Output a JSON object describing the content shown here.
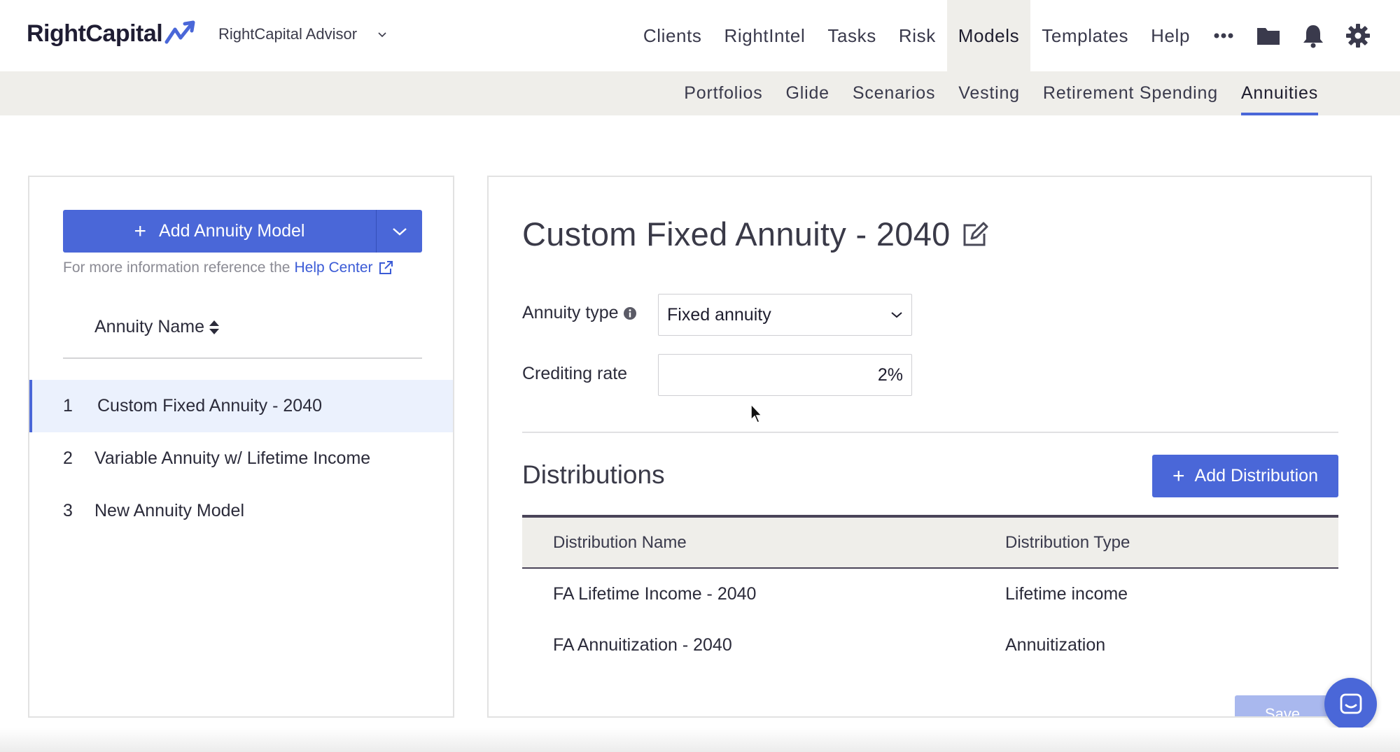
{
  "brand": {
    "logo_text": "RightCapital",
    "accent": "#4a67d8"
  },
  "advisor": {
    "label": "RightCapital Advisor"
  },
  "nav": {
    "items": [
      {
        "label": "Clients"
      },
      {
        "label": "RightIntel"
      },
      {
        "label": "Tasks"
      },
      {
        "label": "Risk"
      },
      {
        "label": "Models"
      },
      {
        "label": "Templates"
      },
      {
        "label": "Help"
      }
    ],
    "active": "Models",
    "icons": [
      "more-icon",
      "folder-icon",
      "bell-icon",
      "gear-icon"
    ]
  },
  "subnav": {
    "items": [
      {
        "label": "Portfolios"
      },
      {
        "label": "Glide"
      },
      {
        "label": "Scenarios"
      },
      {
        "label": "Vesting"
      },
      {
        "label": "Retirement Spending"
      },
      {
        "label": "Annuities"
      }
    ],
    "active": "Annuities"
  },
  "left": {
    "add_button": "Add Annuity Model",
    "help_prefix": "For more information reference the",
    "help_link": "Help Center",
    "column_header": "Annuity Name",
    "annuities": [
      {
        "index": "1",
        "name": "Custom Fixed Annuity - 2040"
      },
      {
        "index": "2",
        "name": "Variable Annuity w/ Lifetime Income"
      },
      {
        "index": "3",
        "name": "New Annuity Model"
      }
    ],
    "selected_index": 0
  },
  "detail": {
    "title": "Custom Fixed Annuity - 2040",
    "annuity_type_label": "Annuity type",
    "annuity_type_value": "Fixed annuity",
    "crediting_rate_label": "Crediting rate",
    "crediting_rate_value": "2%",
    "distributions_title": "Distributions",
    "add_distribution": "Add Distribution",
    "table_headers": {
      "name": "Distribution Name",
      "type": "Distribution Type"
    },
    "distributions": [
      {
        "name": "FA Lifetime Income - 2040",
        "type": "Lifetime income"
      },
      {
        "name": "FA Annuitization - 2040",
        "type": "Annuitization"
      }
    ],
    "save_label": "Save"
  }
}
